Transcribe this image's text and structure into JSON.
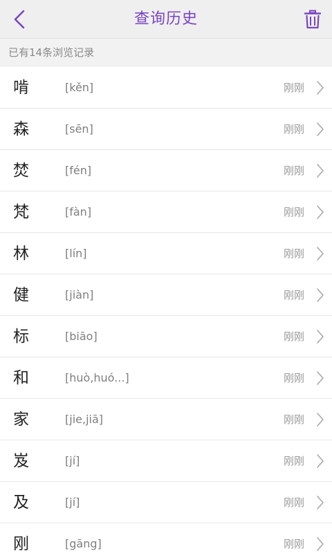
{
  "header": {
    "title": "查询历史",
    "back_icon": "chevron-left-icon",
    "delete_icon": "trash-icon",
    "accent_color": "#7a45c2"
  },
  "count_bar": {
    "text": "已有14条浏览记录"
  },
  "history": [
    {
      "char": "啃",
      "pinyin": "[kěn]",
      "time": "刚刚"
    },
    {
      "char": "森",
      "pinyin": "[sēn]",
      "time": "刚刚"
    },
    {
      "char": "焚",
      "pinyin": "[fén]",
      "time": "刚刚"
    },
    {
      "char": "梵",
      "pinyin": "[fàn]",
      "time": "刚刚"
    },
    {
      "char": "林",
      "pinyin": "[lín]",
      "time": "刚刚"
    },
    {
      "char": "健",
      "pinyin": "[jiàn]",
      "time": "刚刚"
    },
    {
      "char": "标",
      "pinyin": "[biāo]",
      "time": "刚刚"
    },
    {
      "char": "和",
      "pinyin": "[huò,huó...]",
      "time": "刚刚"
    },
    {
      "char": "家",
      "pinyin": "[jie,jiā]",
      "time": "刚刚"
    },
    {
      "char": "岌",
      "pinyin": "[jí]",
      "time": "刚刚"
    },
    {
      "char": "及",
      "pinyin": "[jí]",
      "time": "刚刚"
    },
    {
      "char": "刚",
      "pinyin": "[gāng]",
      "time": "刚刚"
    }
  ]
}
